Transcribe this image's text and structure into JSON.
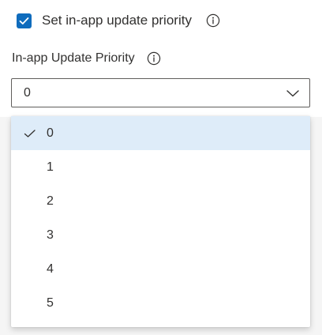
{
  "checkbox": {
    "label": "Set in-app update priority",
    "checked": true,
    "info_icon": "info-icon"
  },
  "field": {
    "label": "In-app Update Priority",
    "info_icon": "info-icon"
  },
  "dropdown": {
    "selected": "0",
    "icon": "chevron-down-icon"
  },
  "menu": {
    "selected_index": 0,
    "check_icon": "checkmark-icon",
    "items": [
      {
        "label": "0"
      },
      {
        "label": "1"
      },
      {
        "label": "2"
      },
      {
        "label": "3"
      },
      {
        "label": "4"
      },
      {
        "label": "5"
      }
    ]
  },
  "colors": {
    "accent": "#0f6cbd",
    "selected_bg": "#deecf9",
    "text": "#323130",
    "border": "#605e5c"
  }
}
